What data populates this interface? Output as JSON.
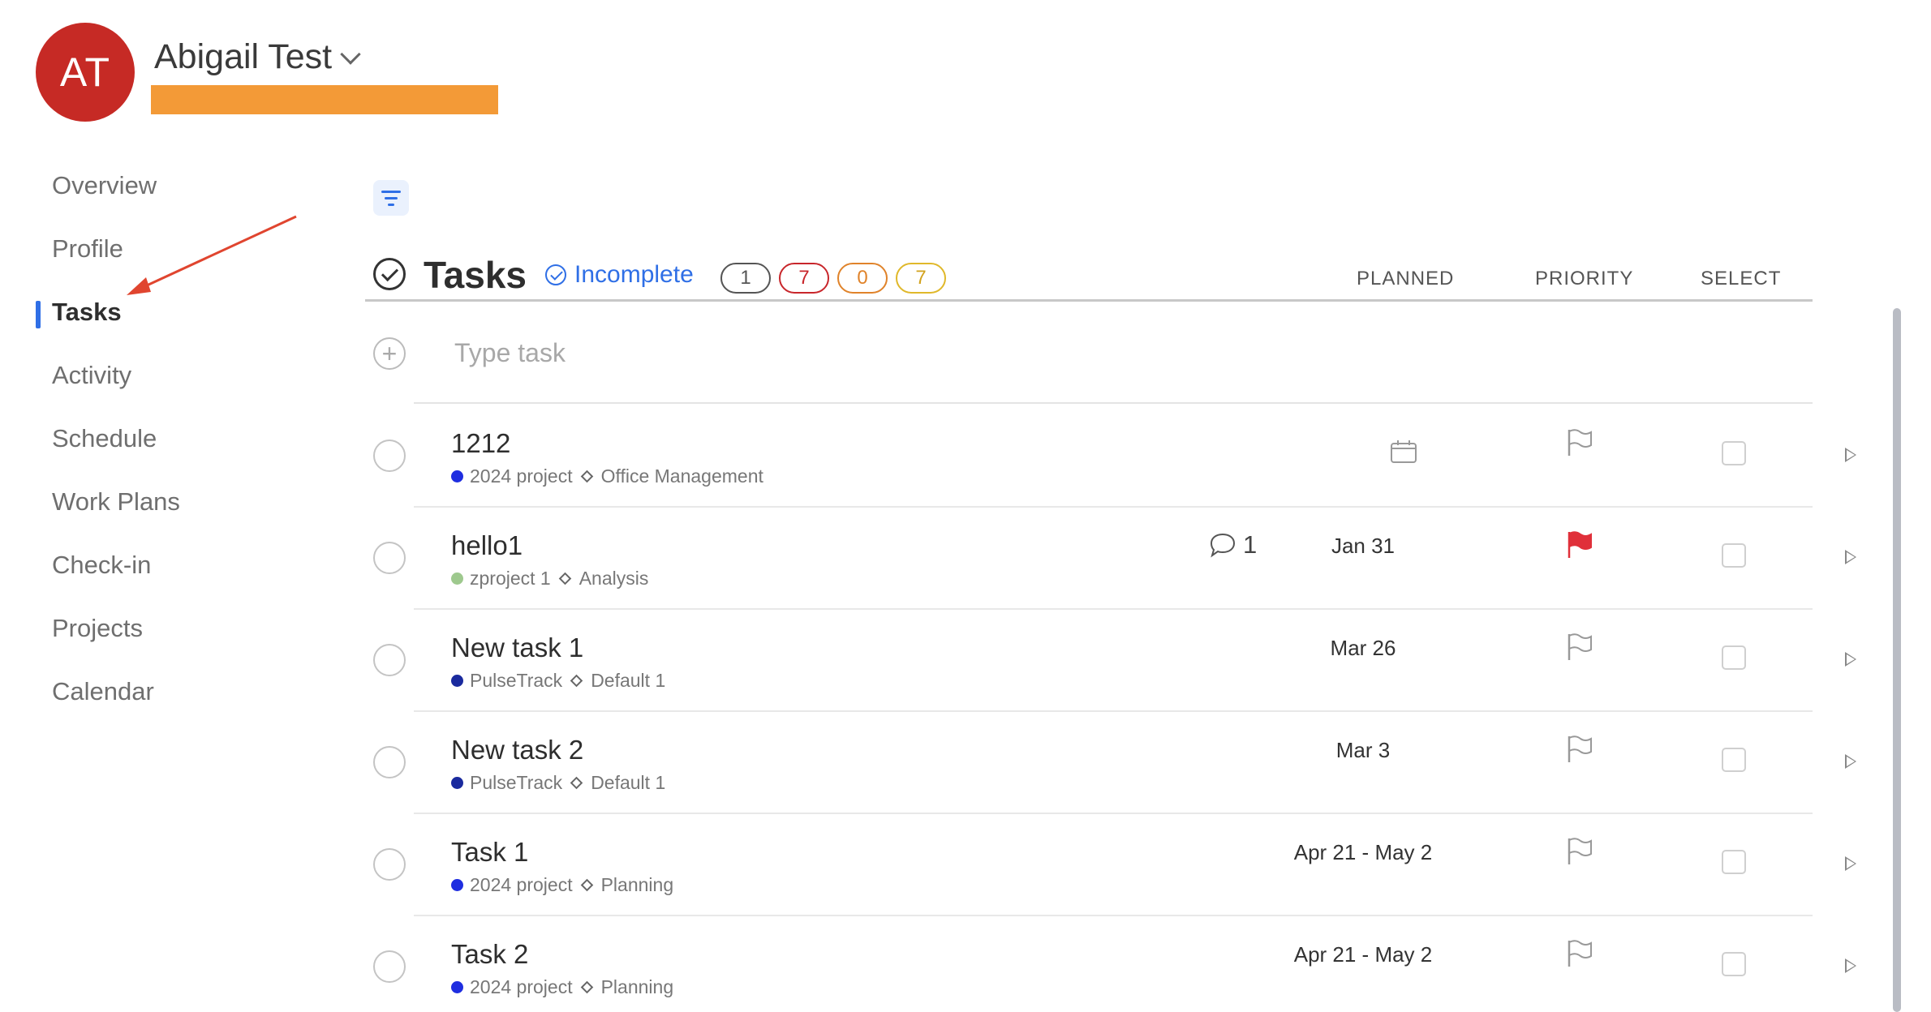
{
  "user": {
    "initials": "AT",
    "name": "Abigail Test",
    "avatar_color": "#c62a25"
  },
  "sidebar": {
    "items": [
      {
        "label": "Overview"
      },
      {
        "label": "Profile"
      },
      {
        "label": "Tasks",
        "active": true
      },
      {
        "label": "Activity"
      },
      {
        "label": "Schedule"
      },
      {
        "label": "Work Plans"
      },
      {
        "label": "Check-in"
      },
      {
        "label": "Projects"
      },
      {
        "label": "Calendar"
      }
    ],
    "accent_color": "#2f6fe6"
  },
  "tasks_header": {
    "title": "Tasks",
    "status_filter": "Incomplete",
    "badges": [
      {
        "count": "1",
        "color": "#555555"
      },
      {
        "count": "7",
        "color": "#c8262b"
      },
      {
        "count": "0",
        "color": "#e0832a"
      },
      {
        "count": "7",
        "color": "#e0b82a"
      }
    ],
    "columns": {
      "planned": "PLANNED",
      "priority": "PRIORITY",
      "select": "SELECT"
    }
  },
  "add_task": {
    "placeholder": "Type task"
  },
  "tasks": [
    {
      "title": "1212",
      "project": "2024 project",
      "project_color": "#1f2ee0",
      "list": "Office Management",
      "comments": "",
      "planned": "",
      "planned_icon": "calendar-icon",
      "priority_flag": "empty"
    },
    {
      "title": "hello1",
      "project": "zproject 1",
      "project_color": "#9ec98e",
      "list": "Analysis",
      "comments": "1",
      "planned": "Jan 31",
      "priority_flag": "red"
    },
    {
      "title": "New task 1",
      "project": "PulseTrack",
      "project_color": "#1a2a9e",
      "list": "Default 1",
      "comments": "",
      "planned": "Mar 26",
      "priority_flag": "empty"
    },
    {
      "title": "New task 2",
      "project": "PulseTrack",
      "project_color": "#1a2a9e",
      "list": "Default 1",
      "comments": "",
      "planned": "Mar 3",
      "priority_flag": "empty"
    },
    {
      "title": "Task 1",
      "project": "2024 project",
      "project_color": "#1f2ee0",
      "list": "Planning",
      "comments": "",
      "planned": "Apr 21 - May 2",
      "priority_flag": "empty"
    },
    {
      "title": "Task 2",
      "project": "2024 project",
      "project_color": "#1f2ee0",
      "list": "Planning",
      "comments": "",
      "planned": "Apr 21 - May 2",
      "priority_flag": "empty"
    }
  ],
  "annotation": {
    "arrow_color": "#e0452f"
  }
}
